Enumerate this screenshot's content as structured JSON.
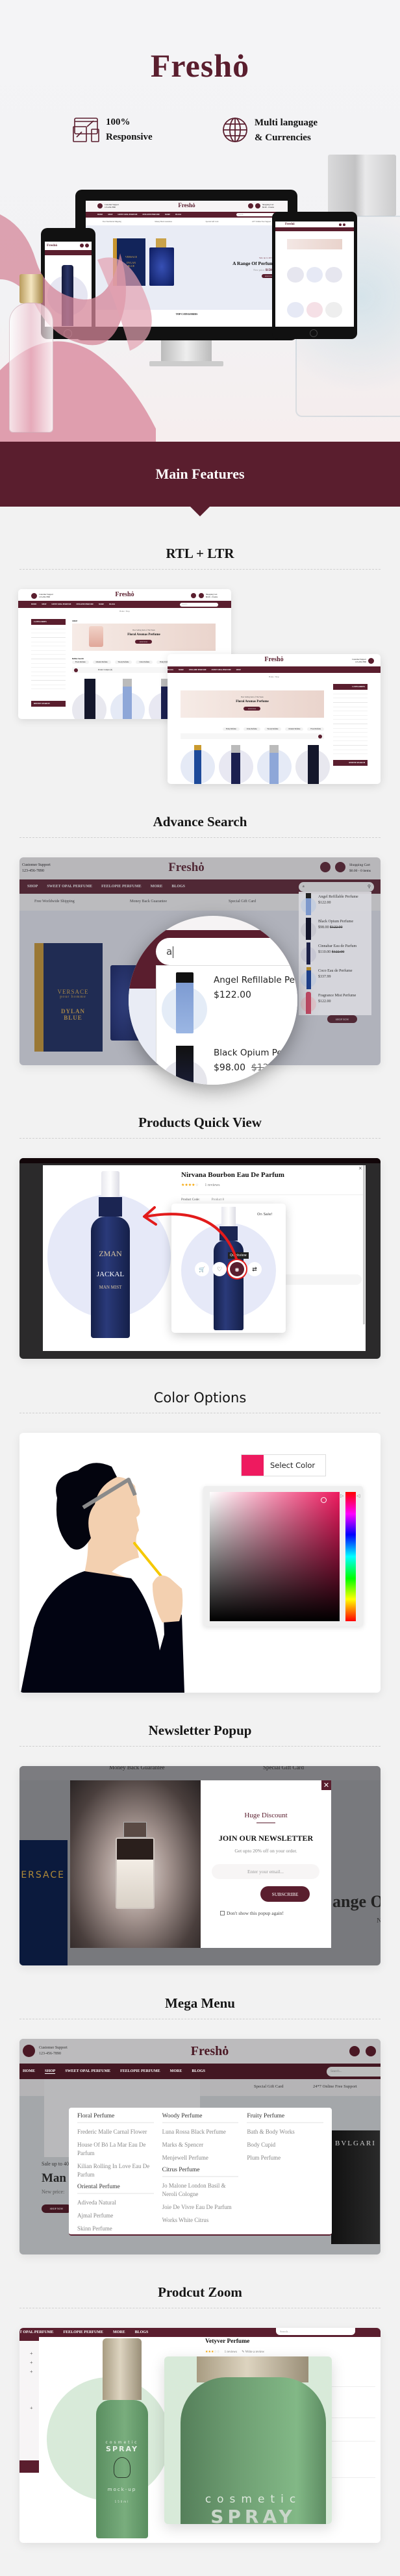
{
  "brand": {
    "logo": "Freshȯ",
    "accent": "#5a1e2e"
  },
  "hero": {
    "features": [
      {
        "icon": "responsive-devices-icon",
        "line1": "100%",
        "line2": "Responsive"
      },
      {
        "icon": "globe-icon",
        "line1": "Multi language",
        "line2": "& Currencies"
      }
    ]
  },
  "store": {
    "support_label": "Customer Support",
    "support_phone": "123-456-7890",
    "cart_label": "Shopping Cart",
    "cart_value": "$0.00 - 0 items",
    "nav": [
      "HOME",
      "SHOP",
      "SWEET OPAL PERFUME",
      "FEELOPIE PERFUME",
      "MORE",
      "BLOGS"
    ],
    "search_placeholder": "Search...",
    "services": [
      "Free Worldwide Shipping",
      "Money Back Guarantee",
      "Special Gift Card",
      "24*7 Online Free Support"
    ],
    "slide": {
      "sale": "Sale up to 40% off",
      "title": "A Range Of Perfume",
      "price_label": "New price:",
      "price": "$150.00",
      "cta": "SHOP NOW"
    },
    "top_categories": "TOP CATEGORIES",
    "product_box": {
      "brand": "VERSACE",
      "sub": "pour homme",
      "name1": "DYLAN",
      "name2": "BLUE"
    }
  },
  "banner": {
    "title": "Main Features"
  },
  "sections": {
    "rtl": "RTL + LTR",
    "search": "Advance Search",
    "quickview": "Products Quick View",
    "color": "Color Options",
    "newsletter": "Newsletter Popup",
    "mega": "Mega Menu",
    "zoom": "Prodcut Zoom"
  },
  "shop_page": {
    "breadcrumb": "Home / Shop",
    "categories_title": "CATEGORIES",
    "refine_title": "REFINE SEARCH",
    "shop_title": "SHOP",
    "banner_kicker": "Best Selling Item of The Week",
    "banner_title": "Floral Aromas Perfume",
    "banner_cta": "SHOP NOW",
    "refine_label": "Refine Search",
    "chips": [
      "Floral Perfume",
      "Oriental Perfume",
      "Woody Perfume",
      "Citrus Perfume",
      "Fruity Perfume"
    ],
    "compare": "Product Compare (0)",
    "sort_label": "Sort By:",
    "sort_value": "Default",
    "show_label": "Show:",
    "show_value": "12",
    "color_label": "Color"
  },
  "search": {
    "query": "a",
    "results": [
      {
        "name": "Angel Refillable Perfume",
        "price": "$122.00",
        "old": ""
      },
      {
        "name": "Black Opium Perfume",
        "price": "$98.00",
        "old": "$122.00"
      },
      {
        "name": "Cinnabar Eau de Parfum",
        "price": "$110.00",
        "old": "$122.00"
      },
      {
        "name": "Coco Eau de Perfume",
        "price": "$337.99",
        "old": ""
      },
      {
        "name": "Fragrance Mist Perfume",
        "price": "$122.00",
        "old": ""
      }
    ]
  },
  "quickview": {
    "title": "Nirvana Bourbon Eau De Parfum",
    "rating": 4,
    "reviews": "1 reviews",
    "code_label": "Product Code:",
    "code_value": "Product 8",
    "badge": "On Sale!",
    "tooltip": "Quickview",
    "close": "×",
    "bottle": {
      "brand": "ZMAN",
      "name": "JACKAL",
      "sub": "MAN MIST"
    }
  },
  "color": {
    "button": "Select Color",
    "swatch": "#ee1a5f"
  },
  "newsletter": {
    "kicker": "Huge Discount",
    "title": "JOIN OUR NEWSLETTER",
    "subtitle": "Get upto 20% off on your order.",
    "email_placeholder": "Enter your email...",
    "subscribe": "SUBSCRIBE",
    "dont_show": "Don't show this popup again!",
    "bg_text": "ange O",
    "bg_text2": "N"
  },
  "mega": {
    "slide": {
      "sale": "Sale up to 40% off",
      "title": "Man",
      "price_label": "New price:",
      "cta": "SHOP NOW"
    },
    "columns": [
      {
        "groups": [
          {
            "title": "Floral Perfume",
            "items": [
              "Frederic Malle Carnal Flower",
              "House Of Bō La Mar Eau De Parfum",
              "Kilian Rolling In Love Eau De Parfum"
            ]
          },
          {
            "title": "Oriental Perfume",
            "items": [
              "Adiveda Natural",
              "Ajmal Perfume",
              "Skinn Perfume"
            ]
          }
        ]
      },
      {
        "groups": [
          {
            "title": "Woody Perfume",
            "items": [
              "Luna Rossa Black Perfume",
              "Marks & Spencer",
              "Menjewell Perfume"
            ]
          },
          {
            "title": "Citrus Perfume",
            "items": [
              "Jo Malone London Basil & Neroli Cologne",
              "Joie De Vivre Eau De Parfum",
              "Works White Citrus"
            ]
          }
        ]
      },
      {
        "groups": [
          {
            "title": "Fruity Perfume",
            "items": [
              "Bath & Body Works",
              "Body Cupid",
              "Plum Perfume"
            ]
          }
        ]
      }
    ],
    "box_text": "BVLGARI"
  },
  "zoom": {
    "nav": [
      "T OPAL PERFUME",
      "FEELOPIE PERFUME",
      "MORE",
      "BLOGS"
    ],
    "title": "Vetyver Perfume",
    "rating": 3,
    "reviews": "1 reviews",
    "write_review": "Write a review",
    "bottle": {
      "line1": "cosmetic",
      "line2": "SPRAY",
      "line3": "mock-up",
      "line4": "150ml"
    }
  }
}
